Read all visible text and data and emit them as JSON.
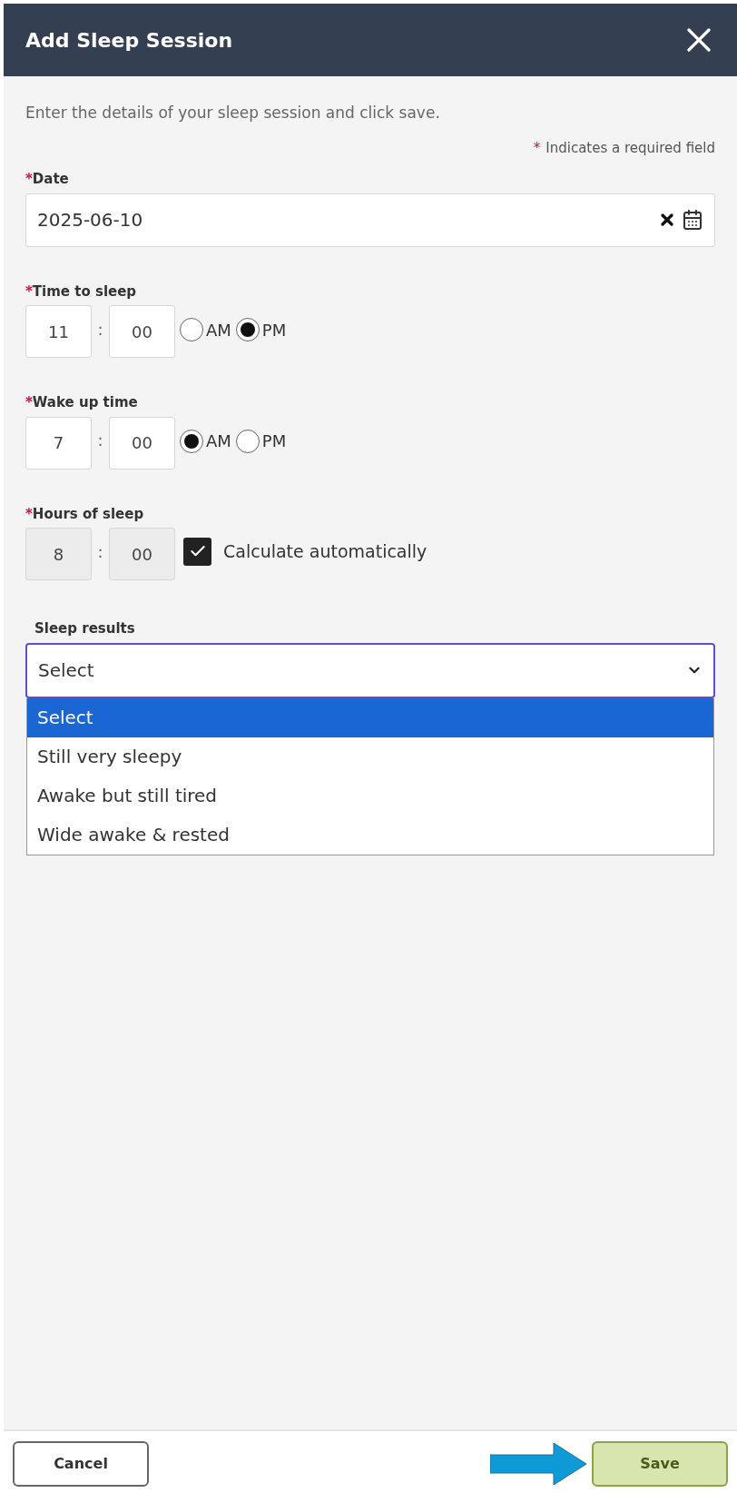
{
  "header": {
    "title": "Add Sleep Session"
  },
  "intro": "Enter the details of your sleep session and click save.",
  "required_note": {
    "marker": "*",
    "text": "Indicates a required field"
  },
  "fields": [
    {
      "kind": "date",
      "marker": "*",
      "label": "Date",
      "value": "2025-06-10"
    },
    {
      "kind": "time",
      "marker": "*",
      "label": "Time to sleep",
      "hour": "11",
      "separator": ":",
      "minute": "00",
      "periods": [
        {
          "label": "AM",
          "selected": false
        },
        {
          "label": "PM",
          "selected": true
        }
      ]
    },
    {
      "kind": "time",
      "marker": "*",
      "label": "Wake up time",
      "hour": "7",
      "separator": ":",
      "minute": "00",
      "periods": [
        {
          "label": "AM",
          "selected": true
        },
        {
          "label": "PM",
          "selected": false
        }
      ]
    },
    {
      "kind": "duration",
      "marker": "*",
      "label": "Hours of sleep",
      "hour": "8",
      "separator": ":",
      "minute": "00",
      "disabled": true,
      "auto": {
        "label": "Calculate automatically",
        "checked": true
      }
    },
    {
      "kind": "select",
      "label": "Sleep results",
      "value": "Select",
      "expanded": true,
      "options": [
        {
          "label": "Select",
          "selected": true
        },
        {
          "label": "Still very sleepy",
          "selected": false
        },
        {
          "label": "Awake but still tired",
          "selected": false
        },
        {
          "label": "Wide awake & rested",
          "selected": false
        }
      ]
    }
  ],
  "footer": {
    "cancel": "Cancel",
    "save": "Save"
  }
}
